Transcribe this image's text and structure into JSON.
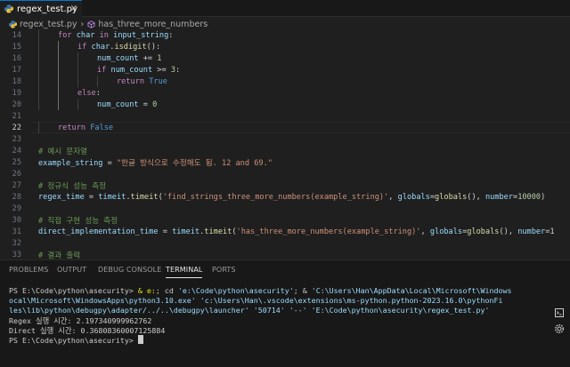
{
  "tab": {
    "filename": "regex_test.py",
    "close_glyph": "×"
  },
  "breadcrumb": {
    "file": "regex_test.py",
    "separator": "›",
    "symbol": "has_three_more_numbers"
  },
  "editor": {
    "lines": [
      {
        "n": "14",
        "tokens": [
          [
            "k",
            "for"
          ],
          [
            "o",
            " "
          ],
          [
            "v",
            "char"
          ],
          [
            "o",
            " "
          ],
          [
            "k",
            "in"
          ],
          [
            "o",
            " "
          ],
          [
            "v",
            "input_string"
          ],
          [
            "o",
            ":"
          ]
        ]
      },
      {
        "n": "15",
        "tokens": [
          [
            "k",
            "if"
          ],
          [
            "o",
            " "
          ],
          [
            "v",
            "char"
          ],
          [
            "o",
            "."
          ],
          [
            "f",
            "isdigit"
          ],
          [
            "o",
            "():"
          ]
        ]
      },
      {
        "n": "16",
        "tokens": [
          [
            "v",
            "num_count"
          ],
          [
            "o",
            " += "
          ],
          [
            "n",
            "1"
          ]
        ]
      },
      {
        "n": "17",
        "tokens": [
          [
            "k",
            "if"
          ],
          [
            "o",
            " "
          ],
          [
            "v",
            "num_count"
          ],
          [
            "o",
            " >= "
          ],
          [
            "n",
            "3"
          ],
          [
            "o",
            ":"
          ]
        ]
      },
      {
        "n": "18",
        "tokens": [
          [
            "k",
            "return"
          ],
          [
            "o",
            " "
          ],
          [
            "b",
            "True"
          ]
        ]
      },
      {
        "n": "19",
        "tokens": [
          [
            "k",
            "else"
          ],
          [
            "o",
            ":"
          ]
        ]
      },
      {
        "n": "20",
        "tokens": [
          [
            "v",
            "num_count"
          ],
          [
            "o",
            " = "
          ],
          [
            "n",
            "0"
          ]
        ]
      },
      {
        "n": "21",
        "tokens": []
      },
      {
        "n": "22",
        "tokens": [
          [
            "k",
            "return"
          ],
          [
            "o",
            " "
          ],
          [
            "b",
            "False"
          ]
        ]
      },
      {
        "n": "23",
        "tokens": []
      },
      {
        "n": "24",
        "tokens": [
          [
            "c",
            "# 예시 문자열"
          ]
        ]
      },
      {
        "n": "25",
        "tokens": [
          [
            "v",
            "example_string"
          ],
          [
            "o",
            " = "
          ],
          [
            "s",
            "\"한글 방식으로 수정해도 됨. 12 and 69.\""
          ]
        ]
      },
      {
        "n": "26",
        "tokens": []
      },
      {
        "n": "27",
        "tokens": [
          [
            "c",
            "# 정규식 성능 측정"
          ]
        ]
      },
      {
        "n": "28",
        "tokens": [
          [
            "v",
            "regex_time"
          ],
          [
            "o",
            " = "
          ],
          [
            "v",
            "timeit"
          ],
          [
            "o",
            "."
          ],
          [
            "f",
            "timeit"
          ],
          [
            "o",
            "("
          ],
          [
            "s",
            "'find_strings_three_more_numbers(example_string)'"
          ],
          [
            "o",
            ", "
          ],
          [
            "v",
            "globals"
          ],
          [
            "o",
            "="
          ],
          [
            "f",
            "globals"
          ],
          [
            "o",
            "(), "
          ],
          [
            "v",
            "number"
          ],
          [
            "o",
            "="
          ],
          [
            "n",
            "10000"
          ],
          [
            "o",
            ")"
          ]
        ]
      },
      {
        "n": "29",
        "tokens": []
      },
      {
        "n": "30",
        "tokens": [
          [
            "c",
            "# 직접 구현 성능 측정"
          ]
        ]
      },
      {
        "n": "31",
        "tokens": [
          [
            "v",
            "direct_implementation_time"
          ],
          [
            "o",
            " = "
          ],
          [
            "v",
            "timeit"
          ],
          [
            "o",
            "."
          ],
          [
            "f",
            "timeit"
          ],
          [
            "o",
            "("
          ],
          [
            "s",
            "'has_three_more_numbers(example_string)'"
          ],
          [
            "o",
            ", "
          ],
          [
            "v",
            "globals"
          ],
          [
            "o",
            "="
          ],
          [
            "f",
            "globals"
          ],
          [
            "o",
            "(), "
          ],
          [
            "v",
            "number"
          ],
          [
            "o",
            "=1"
          ]
        ]
      },
      {
        "n": "32",
        "tokens": []
      },
      {
        "n": "33",
        "tokens": [
          [
            "c",
            "# 결과 출력"
          ]
        ]
      }
    ],
    "current_line": "22"
  },
  "panel": {
    "tabs": [
      "PROBLEMS",
      "OUTPUT",
      "DEBUG CONSOLE",
      "TERMINAL",
      "PORTS"
    ],
    "active_tab": "TERMINAL",
    "terminal": {
      "prompt1": "PS E:\\Code\\python\\asecurity> ",
      "cmd_ampersand": "& ",
      "cmd_e": "e:",
      "cmd_rest": "; cd ",
      "cmd_path1": "'e:\\Code\\python\\asecurity'",
      "cmd_sep": "; & ",
      "cmd_py1": "'C:\\Users\\Han\\AppData\\Local\\Microsoft\\Windows",
      "line2": "ocal\\Microsoft\\WindowsApps\\python3.10.exe'",
      "line2b": " 'c:\\Users\\Han\\.vscode\\extensions\\ms-python.python-2023.16.0\\pythonFi",
      "line3": "les\\lib\\python\\debugpy\\adapter/../..\\debugpy\\launcher' '50714' '--' 'E:\\Code\\python\\asecurity\\regex_test.py'",
      "out1": "Regex 실행 시간: 2.197340999962762",
      "out2": "Direct 실행 시간: 0.36808360007125884",
      "prompt2": "PS E:\\Code\\python\\asecurity> "
    }
  }
}
